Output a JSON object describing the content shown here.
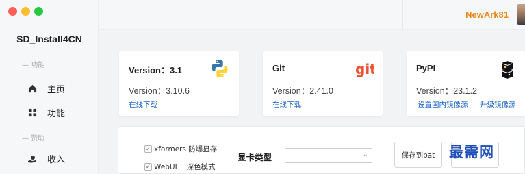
{
  "window": {
    "controls": [
      "close",
      "minimize",
      "maximize"
    ]
  },
  "sidebar": {
    "app_title": "SD_Install4CN",
    "sections": [
      {
        "label": "功能",
        "items": [
          {
            "label": "主页",
            "icon": "home-icon"
          },
          {
            "label": "功能",
            "icon": "grid-icon"
          }
        ]
      },
      {
        "label": "赞助",
        "items": [
          {
            "label": "收入",
            "icon": "coin-hand-icon"
          }
        ]
      }
    ]
  },
  "header": {
    "username": "NewArk81",
    "username_color": "#e8891c"
  },
  "cards": {
    "python": {
      "title": "Version：3.1",
      "version": "Version：3.10.6",
      "link": "在线下载",
      "logo": "python-logo"
    },
    "git": {
      "title": "Git",
      "version": "Version：2.41.0",
      "link": "在线下载",
      "logo": "git-logo"
    },
    "pypi": {
      "title": "PyPI",
      "version": "Version：23.1.2",
      "link1": "设置国内镜像源",
      "link2": "升级镜像源",
      "logo": "pypi-logo"
    }
  },
  "panel": {
    "xformers": {
      "label": "xformers 防爆显存",
      "checked": true
    },
    "webui": {
      "label": "WebUI",
      "extra": "深色模式",
      "checked": true
    },
    "gpu_label": "显卡类型",
    "gpu_select_value": "",
    "save_bat": "保存到bat"
  },
  "watermark": "最需网",
  "colors": {
    "link": "#1a63c6",
    "accent": "#e8891c",
    "git": "#f05033",
    "python_blue": "#3776ab",
    "python_yellow": "#ffd43b"
  }
}
